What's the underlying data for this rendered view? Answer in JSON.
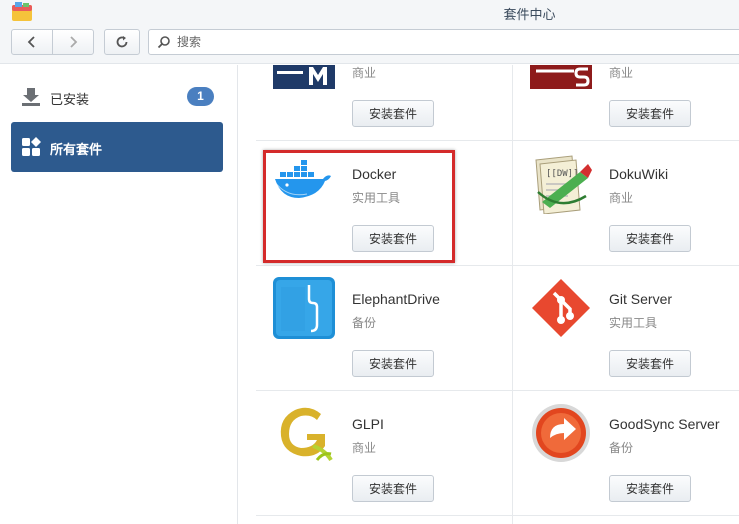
{
  "window": {
    "title": "套件中心"
  },
  "toolbar": {
    "search_placeholder": "搜索"
  },
  "sidebar": {
    "items": [
      {
        "label": "已安装",
        "badge": "1",
        "icon": "download-icon"
      },
      {
        "label": "所有套件",
        "icon": "grid-icon"
      }
    ]
  },
  "packages": [
    {
      "name": "",
      "category": "商业",
      "button": "安装套件"
    },
    {
      "name": "",
      "category": "商业",
      "button": "安装套件"
    },
    {
      "name": "Docker",
      "category": "实用工具",
      "button": "安装套件"
    },
    {
      "name": "DokuWiki",
      "category": "商业",
      "button": "安装套件"
    },
    {
      "name": "ElephantDrive",
      "category": "备份",
      "button": "安装套件"
    },
    {
      "name": "Git Server",
      "category": "实用工具",
      "button": "安装套件"
    },
    {
      "name": "GLPI",
      "category": "商业",
      "button": "安装套件"
    },
    {
      "name": "GoodSync Server",
      "category": "备份",
      "button": "安装套件"
    }
  ],
  "colors": {
    "accent": "#2d5a8e",
    "highlight": "#d42a2a",
    "badge": "#4a7fc0"
  }
}
